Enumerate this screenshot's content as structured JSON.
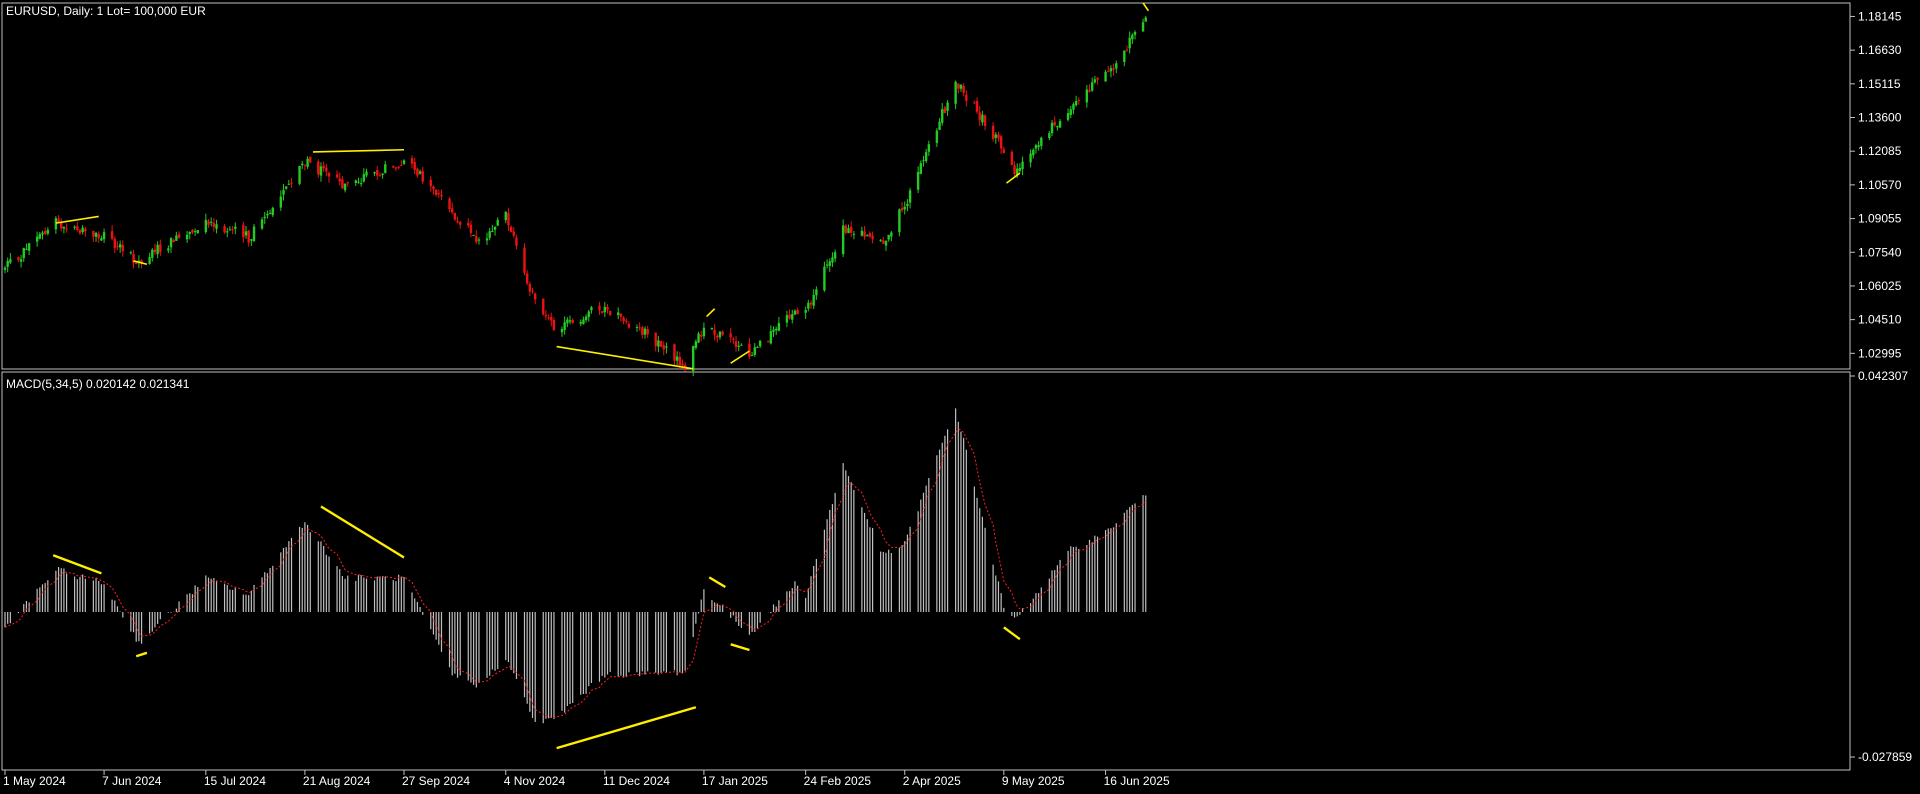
{
  "price_panel": {
    "title": "EURUSD, Daily:  1 Lot= 100,000 EUR",
    "y_ticks": [
      "1.18145",
      "1.16630",
      "1.15115",
      "1.13600",
      "1.12085",
      "1.10570",
      "1.09055",
      "1.07540",
      "1.06025",
      "1.04510",
      "1.02995"
    ]
  },
  "macd_panel": {
    "title": "MACD(5,34,5) 0.020142 0.021341",
    "y_ticks": [
      "0.042307",
      "-0.027859"
    ]
  },
  "x_ticks": [
    "1 May 2024",
    "7 Jun 2024",
    "15 Jul 2024",
    "21 Aug 2024",
    "27 Sep 2024",
    "4 Nov 2024",
    "11 Dec 2024",
    "17 Jan 2025",
    "24 Feb 2025",
    "2 Apr 2025",
    "9 May 2025",
    "16 Jun 2025"
  ],
  "colors": {
    "background": "#000000",
    "bull": "#22cc22",
    "bear": "#ee1111",
    "histogram": "#c0c0c0",
    "signal": "#ff2020",
    "divergence": "#ffee00",
    "frame": "#c0c0c0"
  },
  "chart_data": [
    {
      "type": "candlestick",
      "series": [
        {
          "name": "EURUSD",
          "x": [
            "2024-05-01",
            "2024-05-20",
            "2024-06-07",
            "2024-06-20",
            "2024-07-15",
            "2024-07-31",
            "2024-08-21",
            "2024-09-05",
            "2024-09-27",
            "2024-10-15",
            "2024-10-25",
            "2024-11-04",
            "2024-11-15",
            "2024-11-22",
            "2024-12-11",
            "2024-12-25",
            "2025-01-10",
            "2025-01-17",
            "2025-02-03",
            "2025-02-20",
            "2025-02-24",
            "2025-03-10",
            "2025-03-25",
            "2025-04-02",
            "2025-04-21",
            "2025-05-09",
            "2025-05-13",
            "2025-06-03",
            "2025-06-16",
            "2025-07-01"
          ],
          "close": [
            1.068,
            1.089,
            1.082,
            1.071,
            1.09,
            1.082,
            1.116,
            1.105,
            1.117,
            1.094,
            1.079,
            1.093,
            1.052,
            1.041,
            1.051,
            1.04,
            1.024,
            1.042,
            1.03,
            1.048,
            1.048,
            1.085,
            1.081,
            1.096,
            1.152,
            1.122,
            1.112,
            1.141,
            1.155,
            1.18
          ]
        }
      ],
      "ylim": [
        1.0229,
        1.1875
      ],
      "annotations": [
        "divergence trendlines"
      ]
    },
    {
      "type": "bar",
      "series": [
        {
          "name": "MACD(5,34,5)",
          "x": [
            "2024-05-01",
            "2024-05-20",
            "2024-06-07",
            "2024-06-20",
            "2024-07-15",
            "2024-07-31",
            "2024-08-21",
            "2024-09-05",
            "2024-09-27",
            "2024-10-15",
            "2024-10-25",
            "2024-11-04",
            "2024-11-15",
            "2024-11-22",
            "2024-12-11",
            "2024-12-25",
            "2025-01-10",
            "2025-01-17",
            "2025-02-03",
            "2025-02-20",
            "2025-02-24",
            "2025-03-10",
            "2025-03-25",
            "2025-04-02",
            "2025-04-21",
            "2025-05-09",
            "2025-05-13",
            "2025-06-03",
            "2025-06-16",
            "2025-07-01"
          ],
          "values": [
            -0.003,
            0.0075,
            0.005,
            -0.0055,
            0.006,
            0.003,
            0.016,
            0.006,
            0.006,
            -0.011,
            -0.013,
            -0.008,
            -0.0195,
            -0.019,
            -0.011,
            -0.011,
            -0.0105,
            0.004,
            -0.004,
            0.005,
            0.003,
            0.026,
            0.01,
            0.012,
            0.036,
            0.001,
            -0.0015,
            0.011,
            0.014,
            0.021
          ]
        }
      ],
      "ylim": [
        -0.027859,
        0.042307
      ],
      "annotations": [
        "divergence trendlines"
      ]
    }
  ]
}
